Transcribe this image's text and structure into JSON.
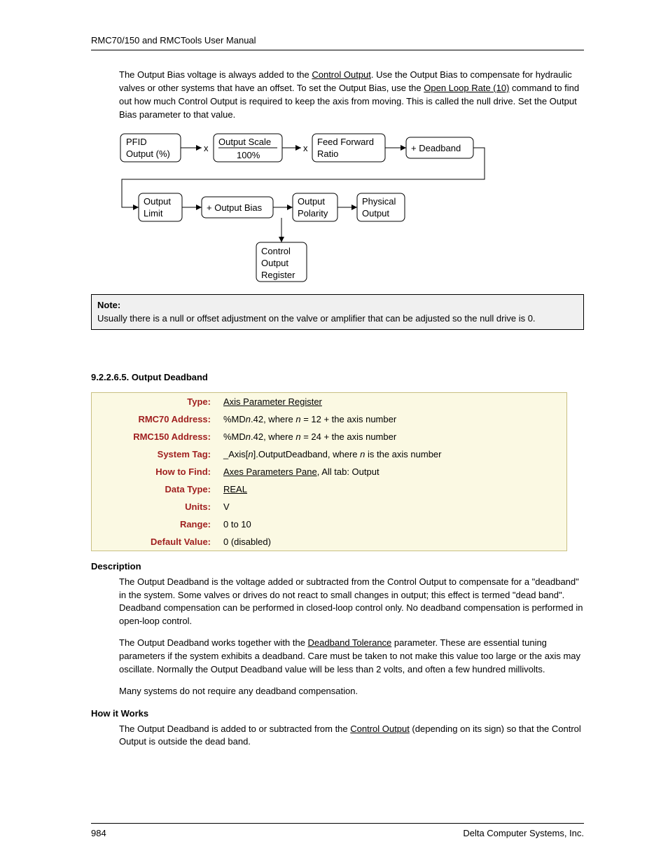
{
  "header": {
    "title": "RMC70/150 and RMCTools User Manual"
  },
  "intro": {
    "pre": "The Output Bias voltage is always added to the ",
    "link1": "Control Output",
    "mid1": ". Use the Output Bias to compensate for hydraulic valves or other systems that have an offset. To set the Output Bias, use the ",
    "link2": "Open Loop Rate (10)",
    "mid2": " command to find out how much Control Output is required to keep the axis from moving. This is called the null drive. Set the Output Bias parameter to that value."
  },
  "diagram": {
    "pfid1": "PFID",
    "pfid2": "Output (%)",
    "x1": "x",
    "outscale1": "Output Scale",
    "outscale2": "100%",
    "x2": "x",
    "ff1": "Feed Forward",
    "ff2": "Ratio",
    "db": "+ Deadband",
    "outlimit1": "Output",
    "outlimit2": "Limit",
    "obias": "+ Output Bias",
    "opol1": "Output",
    "opol2": "Polarity",
    "phys1": "Physical",
    "phys2": "Output",
    "creg1": "Control",
    "creg2": "Output",
    "creg3": "Register"
  },
  "note": {
    "label": "Note:",
    "text": "Usually there is a null or offset adjustment on the valve or amplifier that can be adjusted so the null drive is 0."
  },
  "section": {
    "num": "9.2.2.6.5. Output Deadband"
  },
  "params": {
    "k_type": "Type:",
    "v_type": "Axis Parameter Register",
    "k_r70": "RMC70 Address:",
    "v_r70_a": "%MD",
    "v_r70_b": ".42, where ",
    "v_r70_c": " = 12 + the axis number",
    "k_r150": "RMC150 Address:",
    "v_r150_a": "%MD",
    "v_r150_b": ".42, where ",
    "v_r150_c": " = 24 + the axis number",
    "k_tag": "System Tag:",
    "v_tag_a": "_Axis[",
    "v_tag_b": "].OutputDeadband, where ",
    "v_tag_c": " is the axis number",
    "k_find": "How to Find:",
    "v_find_link": "Axes Parameters Pane",
    "v_find_rest": ", All tab: Output",
    "k_dtype": "Data Type:",
    "v_dtype": "REAL",
    "k_units": "Units:",
    "v_units": "V",
    "k_range": "Range:",
    "v_range": "0 to 10",
    "k_default": "Default Value:",
    "v_default": "0 (disabled)",
    "n": "n"
  },
  "desc": {
    "head": "Description",
    "p1": "The Output Deadband is the voltage added or subtracted from the Control Output to compensate for a \"deadband\" in the system. Some valves or drives do not react to small changes in output; this effect is termed \"dead band\". Deadband compensation can be performed in closed-loop control only. No deadband compensation is performed in open-loop control.",
    "p2a": "The Output Deadband works together with the ",
    "p2link": "Deadband Tolerance",
    "p2b": " parameter. These are essential tuning parameters if the system exhibits a deadband. Care must be taken to not make this value too large or the axis may oscillate. Normally the Output Deadband value will be less than 2 volts, and often a few hundred millivolts.",
    "p3": "Many systems do not require any deadband compensation."
  },
  "how": {
    "head": "How it Works",
    "p1a": "The Output Deadband is added to or subtracted from the ",
    "p1link": "Control Output",
    "p1b": " (depending on its sign) so that the Control Output is outside the dead band."
  },
  "footer": {
    "page": "984",
    "company": "Delta Computer Systems, Inc."
  }
}
